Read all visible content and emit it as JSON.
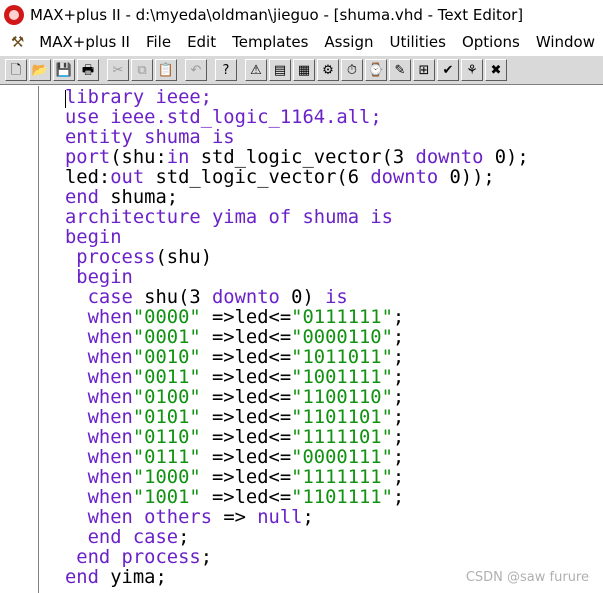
{
  "window": {
    "title": "MAX+plus II - d:\\myeda\\oldman\\jieguo - [shuma.vhd - Text Editor]"
  },
  "menubar": {
    "items": [
      "MAX+plus II",
      "File",
      "Edit",
      "Templates",
      "Assign",
      "Utilities",
      "Options",
      "Window"
    ]
  },
  "toolbar": {
    "buttons": [
      {
        "name": "new-icon",
        "glyph": "🗋"
      },
      {
        "name": "open-icon",
        "glyph": "📂"
      },
      {
        "name": "save-icon",
        "glyph": "💾"
      },
      {
        "name": "print-icon",
        "glyph": "🖶"
      },
      {
        "name": "cut-icon",
        "glyph": "✂",
        "disabled": true
      },
      {
        "name": "copy-icon",
        "glyph": "⧉",
        "disabled": true
      },
      {
        "name": "paste-icon",
        "glyph": "📋"
      },
      {
        "name": "undo-icon",
        "glyph": "↶",
        "disabled": true
      },
      {
        "name": "help-icon",
        "glyph": "?"
      },
      {
        "name": "warning-icon",
        "glyph": "⚠"
      },
      {
        "name": "hierarchy-icon",
        "glyph": "▤"
      },
      {
        "name": "floorplan-icon",
        "glyph": "▦"
      },
      {
        "name": "compile-icon",
        "glyph": "⚙"
      },
      {
        "name": "simulate-icon",
        "glyph": "⏱"
      },
      {
        "name": "timing-icon",
        "glyph": "⌚"
      },
      {
        "name": "program-icon",
        "glyph": "✎"
      },
      {
        "name": "project-icon",
        "glyph": "⊞"
      },
      {
        "name": "save-check-icon",
        "glyph": "✔"
      },
      {
        "name": "hierarchy-top-icon",
        "glyph": "⚘"
      },
      {
        "name": "close-icon",
        "glyph": "✖"
      }
    ]
  },
  "editor": {
    "lines": [
      [
        {
          "t": "library ieee;",
          "c": "kw"
        }
      ],
      [
        {
          "t": "use ",
          "c": "kw"
        },
        {
          "t": "ieee.std_logic_1164.",
          "c": "kw"
        },
        {
          "t": "all",
          "c": "kw"
        },
        {
          "t": ";",
          "c": "kw"
        }
      ],
      [
        {
          "t": "entity ",
          "c": "kw"
        },
        {
          "t": "shuma ",
          "c": "kw"
        },
        {
          "t": "is",
          "c": "kw"
        }
      ],
      [
        {
          "t": "port",
          "c": "kw"
        },
        {
          "t": "(shu:",
          "c": "ty"
        },
        {
          "t": "in ",
          "c": "kw"
        },
        {
          "t": "std_logic_vector(3 ",
          "c": "ty"
        },
        {
          "t": "downto ",
          "c": "kw"
        },
        {
          "t": "0);",
          "c": "ty"
        }
      ],
      [
        {
          "t": "led:",
          "c": "ty"
        },
        {
          "t": "out ",
          "c": "kw"
        },
        {
          "t": "std_logic_vector(6 ",
          "c": "ty"
        },
        {
          "t": "downto ",
          "c": "kw"
        },
        {
          "t": "0));",
          "c": "ty"
        }
      ],
      [
        {
          "t": "end ",
          "c": "kw"
        },
        {
          "t": "shuma;",
          "c": "ty"
        }
      ],
      [
        {
          "t": "architecture ",
          "c": "kw"
        },
        {
          "t": "yima ",
          "c": "kw"
        },
        {
          "t": "of ",
          "c": "kw"
        },
        {
          "t": "shuma ",
          "c": "kw"
        },
        {
          "t": "is",
          "c": "kw"
        }
      ],
      [
        {
          "t": "begin",
          "c": "kw"
        }
      ],
      [
        {
          "t": " process",
          "c": "kw"
        },
        {
          "t": "(shu)",
          "c": "ty"
        }
      ],
      [
        {
          "t": " begin",
          "c": "kw"
        }
      ],
      [
        {
          "t": "  case ",
          "c": "kw"
        },
        {
          "t": "shu(3 ",
          "c": "ty"
        },
        {
          "t": "downto ",
          "c": "kw"
        },
        {
          "t": "0) ",
          "c": "ty"
        },
        {
          "t": "is",
          "c": "kw"
        }
      ],
      [
        {
          "t": "  when",
          "c": "kw"
        },
        {
          "t": "\"0000\"",
          "c": "str"
        },
        {
          "t": " =>led<=",
          "c": "ty"
        },
        {
          "t": "\"0111111\"",
          "c": "str"
        },
        {
          "t": ";",
          "c": "ty"
        }
      ],
      [
        {
          "t": "  when",
          "c": "kw"
        },
        {
          "t": "\"0001\"",
          "c": "str"
        },
        {
          "t": " =>led<=",
          "c": "ty"
        },
        {
          "t": "\"0000110\"",
          "c": "str"
        },
        {
          "t": ";",
          "c": "ty"
        }
      ],
      [
        {
          "t": "  when",
          "c": "kw"
        },
        {
          "t": "\"0010\"",
          "c": "str"
        },
        {
          "t": " =>led<=",
          "c": "ty"
        },
        {
          "t": "\"1011011\"",
          "c": "str"
        },
        {
          "t": ";",
          "c": "ty"
        }
      ],
      [
        {
          "t": "  when",
          "c": "kw"
        },
        {
          "t": "\"0011\"",
          "c": "str"
        },
        {
          "t": " =>led<=",
          "c": "ty"
        },
        {
          "t": "\"1001111\"",
          "c": "str"
        },
        {
          "t": ";",
          "c": "ty"
        }
      ],
      [
        {
          "t": "  when",
          "c": "kw"
        },
        {
          "t": "\"0100\"",
          "c": "str"
        },
        {
          "t": " =>led<=",
          "c": "ty"
        },
        {
          "t": "\"1100110\"",
          "c": "str"
        },
        {
          "t": ";",
          "c": "ty"
        }
      ],
      [
        {
          "t": "  when",
          "c": "kw"
        },
        {
          "t": "\"0101\"",
          "c": "str"
        },
        {
          "t": " =>led<=",
          "c": "ty"
        },
        {
          "t": "\"1101101\"",
          "c": "str"
        },
        {
          "t": ";",
          "c": "ty"
        }
      ],
      [
        {
          "t": "  when",
          "c": "kw"
        },
        {
          "t": "\"0110\"",
          "c": "str"
        },
        {
          "t": " =>led<=",
          "c": "ty"
        },
        {
          "t": "\"1111101\"",
          "c": "str"
        },
        {
          "t": ";",
          "c": "ty"
        }
      ],
      [
        {
          "t": "  when",
          "c": "kw"
        },
        {
          "t": "\"0111\"",
          "c": "str"
        },
        {
          "t": " =>led<=",
          "c": "ty"
        },
        {
          "t": "\"0000111\"",
          "c": "str"
        },
        {
          "t": ";",
          "c": "ty"
        }
      ],
      [
        {
          "t": "  when",
          "c": "kw"
        },
        {
          "t": "\"1000\"",
          "c": "str"
        },
        {
          "t": " =>led<=",
          "c": "ty"
        },
        {
          "t": "\"1111111\"",
          "c": "str"
        },
        {
          "t": ";",
          "c": "ty"
        }
      ],
      [
        {
          "t": "  when",
          "c": "kw"
        },
        {
          "t": "\"1001\"",
          "c": "str"
        },
        {
          "t": " =>led<=",
          "c": "ty"
        },
        {
          "t": "\"1101111\"",
          "c": "str"
        },
        {
          "t": ";",
          "c": "ty"
        }
      ],
      [
        {
          "t": "  when ",
          "c": "kw"
        },
        {
          "t": "others ",
          "c": "kw"
        },
        {
          "t": "=> ",
          "c": "ty"
        },
        {
          "t": "null",
          "c": "kw"
        },
        {
          "t": ";",
          "c": "ty"
        }
      ],
      [
        {
          "t": "  end ",
          "c": "kw"
        },
        {
          "t": "case",
          "c": "kw"
        },
        {
          "t": ";",
          "c": "ty"
        }
      ],
      [
        {
          "t": " end ",
          "c": "kw"
        },
        {
          "t": "process",
          "c": "kw"
        },
        {
          "t": ";",
          "c": "ty"
        }
      ],
      [
        {
          "t": "end ",
          "c": "kw"
        },
        {
          "t": "yima;",
          "c": "ty"
        }
      ]
    ]
  },
  "watermark": "CSDN @saw furure",
  "colors": {
    "keyword": "#6a22c8",
    "string": "#119211",
    "text": "#000000"
  }
}
